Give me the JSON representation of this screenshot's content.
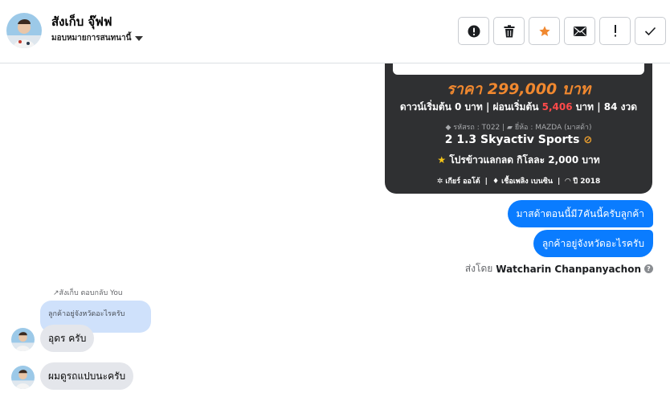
{
  "header": {
    "contact_name": "สังเก็บ จุ๊ฟฟ",
    "assign_label": "มอบหมายการสนทนานี้",
    "actions": [
      {
        "name": "report-button",
        "icon": "exclamation-circle-icon"
      },
      {
        "name": "delete-button",
        "icon": "trash-icon"
      },
      {
        "name": "star-button",
        "icon": "star-icon",
        "color": "#f0882f"
      },
      {
        "name": "mail-button",
        "icon": "envelope-icon"
      },
      {
        "name": "important-button",
        "icon": "exclamation-icon"
      },
      {
        "name": "done-button",
        "icon": "check-icon"
      }
    ]
  },
  "car_card": {
    "price": "ราคา 299,000 บาท",
    "down_prefix": "ดาวน์เริ่มต้น 0 บาท | ผ่อนเริ่มต้น ",
    "installment": "5,406",
    "down_suffix": " บาท | 84 งวด",
    "code": "รหัสรถ : T022",
    "brand": "ยี่ห้อ : MAZDA (มาสด้า)",
    "model": "2 1.3 Skyactiv Sports",
    "promo": "โปรข้าวแลกลด กิโลละ 2,000 บาท",
    "gear": "เกียร์ ออโต้",
    "fuel": "เชื้อเพลิง เบนซิน",
    "year": "ปี 2018",
    "price_color": "#f0882f",
    "installment_color": "#ff4a4a"
  },
  "messages_out": [
    {
      "text": "มาสด้าตอนนี้มี7คันนี้ครับลูกค้า"
    },
    {
      "text": "ลูกค้าอยู่จังหวัดอะไรครับ"
    }
  ],
  "sent_by": {
    "prefix": "ส่งโดย",
    "name": "Watcharin Chanpanyachon",
    "help": "?"
  },
  "reply": {
    "label": "สังเก็บ ตอบกลับ You",
    "quoted": "ลูกค้าอยู่จังหวัดอะไรครับ"
  },
  "messages_in": [
    {
      "text": "อุดร ครับ"
    },
    {
      "text": "ผมดูรถแปบนะครับ"
    }
  ],
  "colors": {
    "accent": "#0a7cff",
    "incoming_bubble": "#e4e6eb",
    "quoted_bubble": "#cfe1fb",
    "card_bg": "#2f3032"
  }
}
